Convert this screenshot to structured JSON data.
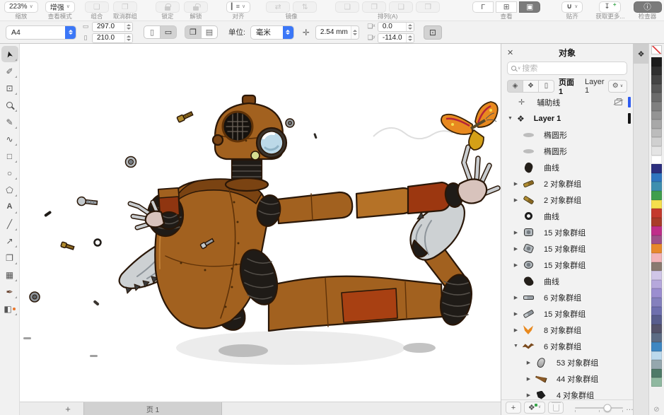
{
  "toolbar": {
    "zoom": {
      "value": "223%",
      "label": "缩放"
    },
    "view_mode": {
      "value": "增强",
      "label": "查看模式"
    },
    "combine_label": "组合",
    "ungroup_label": "取消群组",
    "lock_label": "锁定",
    "unlock_label": "解锁",
    "align_label": "对齐",
    "mirror_label": "镜像",
    "arrange_label": "排列(A)",
    "view_label": "查看",
    "snap_label": "贴齐",
    "get_more_label": "获取更多...",
    "inspector_label": "检查器"
  },
  "icons": {
    "combine": "❏",
    "ungroup": "❐",
    "align_glyph": "▎≡",
    "mirror_h": "⇄",
    "mirror_v": "⇅",
    "arrange_1": "❏",
    "arrange_2": "❐",
    "arrange_3": "❑",
    "arrange_4": "❒",
    "view_wireframe": "Γ",
    "view_grid": "⊞",
    "view_preview": "▣",
    "snap_magnet": "∪",
    "get_more_arrow": "↧",
    "inspector_info": "ⓘ",
    "page_width": "▭",
    "page_height": "▯",
    "portrait": "▯",
    "landscape": "▭",
    "layout_a": "❐",
    "layout_b": "▤",
    "nudge_cross": "✛",
    "dup_x": "❏ˣ",
    "dup_y": "❏ʸ",
    "select_toggle": "⊡",
    "panel_close": "✕",
    "layers_diamond": "❖",
    "btn_visibility": "◈",
    "btn_layers": "❖",
    "btn_page": "▯",
    "gear": "⚙",
    "chevron_small": "∨",
    "guides_cross": "✛",
    "expand_open": "▼",
    "expand_closed": "▶",
    "plus": "+",
    "ellipsis": "…",
    "palette_more": "⊘"
  },
  "propbar": {
    "page_size_preset": "A4",
    "page_width": "297.0",
    "page_height": "210.0",
    "units_label": "单位:",
    "units_value": "毫米",
    "nudge_distance": "2.54 mm",
    "duplicate_x": "0.0",
    "duplicate_y": "-114.0"
  },
  "toolbox": {
    "tools": [
      {
        "name": "tool-pick",
        "glyph": "➤",
        "selected": true
      },
      {
        "name": "tool-shape",
        "glyph": "✐",
        "selected": false
      },
      {
        "name": "tool-crop",
        "glyph": "⊡",
        "selected": false
      },
      {
        "name": "tool-zoom",
        "glyph": "",
        "selected": false
      },
      {
        "name": "tool-freehand",
        "glyph": "✎",
        "selected": false
      },
      {
        "name": "tool-artistic-media",
        "glyph": "∿",
        "selected": false
      },
      {
        "name": "tool-rectangle",
        "glyph": "□",
        "selected": false
      },
      {
        "name": "tool-ellipse",
        "glyph": "○",
        "selected": false
      },
      {
        "name": "tool-polygon",
        "glyph": "⬠",
        "selected": false
      },
      {
        "name": "tool-text",
        "glyph": "A",
        "selected": false
      },
      {
        "name": "tool-line",
        "glyph": "╱",
        "selected": false
      },
      {
        "name": "tool-connector",
        "glyph": "↗",
        "selected": false
      },
      {
        "name": "tool-shadow",
        "glyph": "❐",
        "selected": false
      },
      {
        "name": "tool-mesh-fill",
        "glyph": "▦",
        "selected": false
      },
      {
        "name": "tool-eyedropper",
        "glyph": "✒",
        "selected": false
      },
      {
        "name": "tool-fill",
        "glyph": "◧",
        "selected": false
      }
    ]
  },
  "objects_panel": {
    "title": "对象",
    "search_placeholder": "搜索",
    "page_label": "页面 1",
    "active_layer_label": "Layer 1",
    "guides_label": "辅助线",
    "guides_bar_color": "#2e5bf0",
    "layer_row_label": "Layer 1",
    "layer_bar_color": "#151515",
    "rows": [
      {
        "label": "椭圆形",
        "chevron": "",
        "thumb": "ellipse",
        "ind": "ind-1"
      },
      {
        "label": "椭圆形",
        "chevron": "",
        "thumb": "ellipse2",
        "ind": "ind-1"
      },
      {
        "label": "曲线",
        "chevron": "",
        "thumb": "blob",
        "ind": "ind-1"
      },
      {
        "label": "2 对象群组",
        "chevron": "▶",
        "thumb": "screw-gold",
        "ind": "ind-1"
      },
      {
        "label": "2 对象群组",
        "chevron": "▶",
        "thumb": "screw-gold2",
        "ind": "ind-1"
      },
      {
        "label": "曲线",
        "chevron": "",
        "thumb": "ring",
        "ind": "ind-1"
      },
      {
        "label": "15 对象群组",
        "chevron": "▶",
        "thumb": "nut",
        "ind": "ind-1"
      },
      {
        "label": "15 对象群组",
        "chevron": "▶",
        "thumb": "nut2",
        "ind": "ind-1"
      },
      {
        "label": "15 对象群组",
        "chevron": "▶",
        "thumb": "nut3",
        "ind": "ind-1"
      },
      {
        "label": "曲线",
        "chevron": "",
        "thumb": "blob2",
        "ind": "ind-1"
      },
      {
        "label": "6 对象群组",
        "chevron": "▶",
        "thumb": "bolt",
        "ind": "ind-1"
      },
      {
        "label": "15 对象群组",
        "chevron": "▶",
        "thumb": "screw-gray",
        "ind": "ind-1"
      },
      {
        "label": "8 对象群组",
        "chevron": "▶",
        "thumb": "butterfly",
        "ind": "ind-1"
      },
      {
        "label": "6 对象群组",
        "chevron": "▼",
        "thumb": "zigzag",
        "ind": "ind-1"
      },
      {
        "label": "53 对象群组",
        "chevron": "▶",
        "thumb": "boot",
        "ind": "ind-2"
      },
      {
        "label": "44 对象群组",
        "chevron": "▶",
        "thumb": "club",
        "ind": "ind-2"
      },
      {
        "label": "4 对象群组",
        "chevron": "▶",
        "thumb": "black-shape",
        "ind": "ind-2"
      }
    ]
  },
  "palette": {
    "colors": [
      "#1c1c1c",
      "#303030",
      "#444444",
      "#585858",
      "#6c6c6c",
      "#808080",
      "#949494",
      "#a8a8a8",
      "#bcbcbc",
      "#d0d0d0",
      "#e4e4e4",
      "#ffffff",
      "#2c2f7e",
      "#2f76c0",
      "#3e8faf",
      "#3f9e4d",
      "#f5df4d",
      "#c43a2e",
      "#a93c2a",
      "#bf2e8a",
      "#9e5089",
      "#e8892c",
      "#f2b3b8",
      "#8a7a70",
      "#d0c6e8",
      "#b6a8dc",
      "#9b8ed0",
      "#8480bd",
      "#6e6fae",
      "#585d8d",
      "#55536a",
      "#5d6c84",
      "#3f87c2",
      "#bcd9ec",
      "#95a7ae",
      "#4e7a68",
      "#8fb8a0"
    ]
  },
  "pagebar": {
    "add_label": "+",
    "tab_label": "页 1"
  }
}
